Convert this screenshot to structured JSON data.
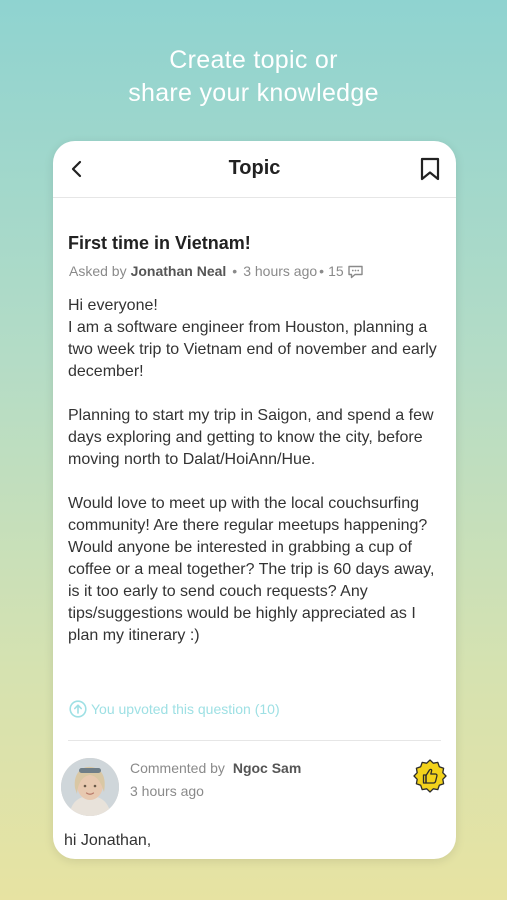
{
  "promo": {
    "line1": "Create topic or",
    "line2": "share your knowledge"
  },
  "nav": {
    "title": "Topic",
    "back_icon": "chevron-left-icon",
    "bookmark_icon": "bookmark-icon"
  },
  "question": {
    "title": "First time in Vietnam!",
    "asked_by_label": "Asked by",
    "author": "Jonathan Neal",
    "separator": "•",
    "time": "3 hours ago",
    "time_sep": "•",
    "comment_count": "15",
    "body": "Hi everyone!\nI am a software engineer from Houston, planning a two week trip to Vietnam end of november and early december!\n\nPlanning to start my trip in Saigon, and spend a few days exploring and getting to know the city, before moving north to Dalat/HoiAnn/Hue.\n\nWould love to meet up with the local couchsurfing community! Are there regular meetups happening? Would anyone be interested in grabbing a cup of coffee or a meal together? The trip is 60 days away, is it too early to send couch requests? Any tips/suggestions would be highly appreciated as I plan my itinerary :)",
    "upvote_text": "You upvoted this question (10)",
    "accent_color": "#9ee0e4"
  },
  "comment": {
    "commented_by_label": "Commented by",
    "author": "Ngoc Sam",
    "time": "3 hours ago",
    "text": "hi Jonathan,",
    "like_badge_color": "#f2d21b"
  }
}
